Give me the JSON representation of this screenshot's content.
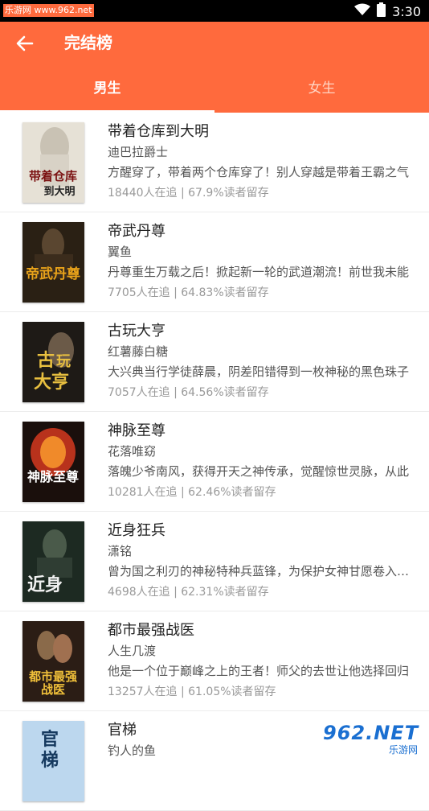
{
  "status_bar": {
    "left_text": "乐游网 www.962.net",
    "time": "3:30"
  },
  "toolbar": {
    "title": "完结榜",
    "back_icon": "arrow-left-icon"
  },
  "tabs": [
    {
      "label": "男生",
      "active": true
    },
    {
      "label": "女生",
      "active": false
    }
  ],
  "books": [
    {
      "title": "带着仓库到大明",
      "author": "迪巴拉爵士",
      "desc": "方醒穿了，带着两个仓库穿了！别人穿越是带着王霸之气",
      "stats": "18440人在追 |  67.9%读者留存",
      "cover_text": "带着仓库到大明"
    },
    {
      "title": "帝武丹尊",
      "author": "翼鱼",
      "desc": "丹尊重生万载之后！掀起新一轮的武道潮流！前世我未能",
      "stats": "7705人在追 |  64.83%读者留存",
      "cover_text": "帝武丹尊"
    },
    {
      "title": "古玩大亨",
      "author": "红薯藤白糖",
      "desc": "大兴典当行学徒薛晨，阴差阳错得到一枚神秘的黑色珠子",
      "stats": "7057人在追 |  64.56%读者留存",
      "cover_text": "古玩大亨"
    },
    {
      "title": "神脉至尊",
      "author": "花落唯窈",
      "desc": "落魄少爷南风，获得开天之神传承，觉醒惊世灵脉，从此",
      "stats": "10281人在追 |  62.46%读者留存",
      "cover_text": "神脉至尊"
    },
    {
      "title": "近身狂兵",
      "author": "潇铭",
      "desc": "曾为国之利刃的神秘特种兵蓝锋，为保护女神甘愿卷入纷争",
      "stats": "4698人在追 |  62.31%读者留存",
      "cover_text": "近身狂兵"
    },
    {
      "title": "都市最强战医",
      "author": "人生几渡",
      "desc": "他是一个位于巅峰之上的王者！师父的去世让他选择回归",
      "stats": "13257人在追 |  61.05%读者留存",
      "cover_text": "都市最强战医"
    },
    {
      "title": "官梯",
      "author": "钓人的鱼",
      "desc": "",
      "stats": "",
      "cover_text": "官梯"
    }
  ],
  "watermark": {
    "main": "962.NET",
    "sub": "乐游网"
  },
  "colors": {
    "accent": "#ff6a3d",
    "tab_inactive": "#ffd3c2"
  }
}
